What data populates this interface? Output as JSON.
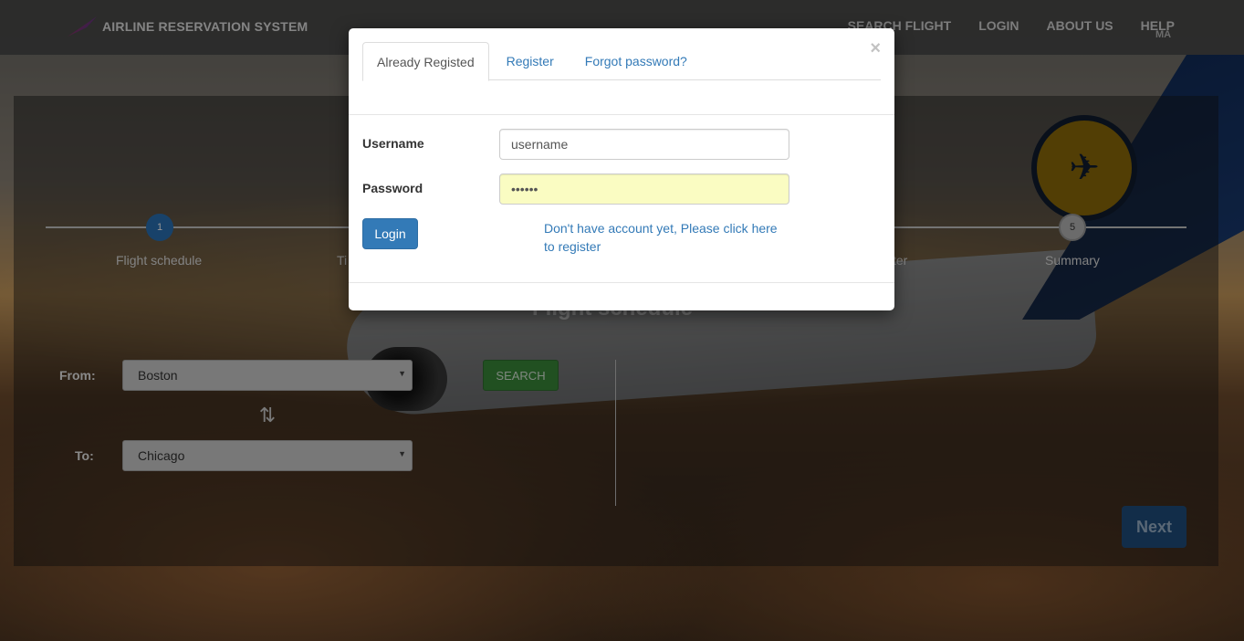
{
  "navbar": {
    "brand": "AIRLINE RESERVATION SYSTEM",
    "links": [
      "SEARCH FLIGHT",
      "LOGIN",
      "ABOUT US",
      "HELP"
    ],
    "avatar": "MA"
  },
  "steps": {
    "step1_number": "1",
    "step1_label": "Flight schedule",
    "step2_label": "Ti",
    "step4_label": "ter",
    "step5_number": "5",
    "step5_label": "Summary"
  },
  "main": {
    "section_title": "Flight schedule",
    "from_label": "From:",
    "from_value": "Boston",
    "to_label": "To:",
    "to_value": "Chicago",
    "search_label": "SEARCH",
    "next_label": "Next"
  },
  "modal": {
    "close": "×",
    "tabs": [
      "Already Registed",
      "Register",
      "Forgot password?"
    ],
    "active_tab": 0,
    "username_label": "Username",
    "username_value": "username",
    "password_label": "Password",
    "password_value": "••••••",
    "login_label": "Login",
    "register_link": "Don't have account yet, Please click here to register"
  },
  "colors": {
    "primary": "#337ab7",
    "autofill": "#fafcc2",
    "search_green": "#3a8a3a"
  },
  "icons": {
    "swap": "swap-icon",
    "close": "close-icon",
    "caret": "chevron-down-icon"
  }
}
